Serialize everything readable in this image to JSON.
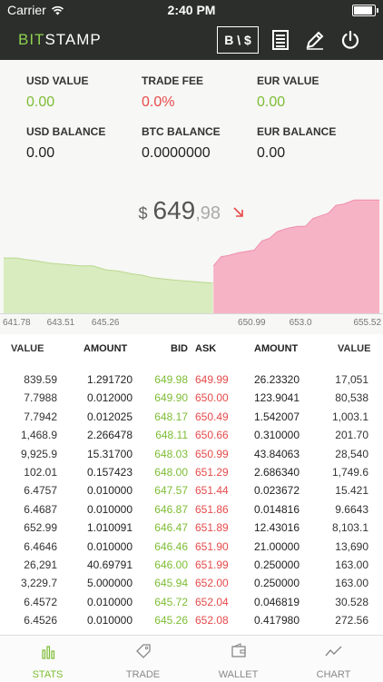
{
  "status_bar": {
    "carrier": "Carrier",
    "time": "2:40 PM",
    "battery_level": 1.0
  },
  "app": {
    "brand_bit": "BIT",
    "brand_stamp": "STAMP",
    "currency_toggle": "B \\ $"
  },
  "colors": {
    "accent_green": "#7dbd34",
    "accent_red": "#e64a4a",
    "nav_bg": "#2b2e2b"
  },
  "stats": [
    {
      "label": "USD VALUE",
      "value": "0.00",
      "tone": "green"
    },
    {
      "label": "TRADE FEE",
      "value": "0.0%",
      "tone": "red"
    },
    {
      "label": "EUR VALUE",
      "value": "0.00",
      "tone": "green"
    },
    {
      "label": "USD BALANCE",
      "value": "0.00",
      "tone": "plain"
    },
    {
      "label": "BTC BALANCE",
      "value": "0.0000000",
      "tone": "plain"
    },
    {
      "label": "EUR BALANCE",
      "value": "0.00",
      "tone": "plain"
    }
  ],
  "price": {
    "currency": "$",
    "main": "649",
    "decimal": ",98",
    "direction": "down"
  },
  "chart_data": {
    "type": "area",
    "x_ticks": [
      "641.78",
      "643.51",
      "645.26",
      "650.99",
      "653.0",
      "655.52"
    ],
    "xlim": [
      641.78,
      656.5
    ],
    "ylim": [
      0,
      1
    ],
    "series": [
      {
        "side": "bid",
        "color": "#d8ecbf",
        "points": [
          [
            641.78,
            0.42
          ],
          [
            642.3,
            0.42
          ],
          [
            642.6,
            0.41
          ],
          [
            643.0,
            0.4
          ],
          [
            643.6,
            0.38
          ],
          [
            644.2,
            0.37
          ],
          [
            644.8,
            0.36
          ],
          [
            645.26,
            0.36
          ],
          [
            645.8,
            0.33
          ],
          [
            646.3,
            0.32
          ],
          [
            646.8,
            0.3
          ],
          [
            647.2,
            0.29
          ],
          [
            647.6,
            0.27
          ],
          [
            648.1,
            0.26
          ],
          [
            648.6,
            0.25
          ],
          [
            649.3,
            0.24
          ],
          [
            649.98,
            0.23
          ]
        ]
      },
      {
        "side": "ask",
        "color": "#f7b3c6",
        "points": [
          [
            650.0,
            0.36
          ],
          [
            650.3,
            0.43
          ],
          [
            650.6,
            0.44
          ],
          [
            650.99,
            0.46
          ],
          [
            651.3,
            0.47
          ],
          [
            651.6,
            0.48
          ],
          [
            651.9,
            0.55
          ],
          [
            652.2,
            0.57
          ],
          [
            652.5,
            0.62
          ],
          [
            652.8,
            0.64
          ],
          [
            653.0,
            0.65
          ],
          [
            653.3,
            0.66
          ],
          [
            653.6,
            0.66
          ],
          [
            653.9,
            0.72
          ],
          [
            654.2,
            0.74
          ],
          [
            654.5,
            0.76
          ],
          [
            654.8,
            0.82
          ],
          [
            655.1,
            0.83
          ],
          [
            655.52,
            0.86
          ],
          [
            656.0,
            0.86
          ],
          [
            656.5,
            0.86
          ]
        ]
      }
    ]
  },
  "order_book": {
    "headers": {
      "value1": "VALUE",
      "amount1": "AMOUNT",
      "bid": "BID",
      "ask": "ASK",
      "amount2": "AMOUNT",
      "value2": "VALUE"
    },
    "rows": [
      [
        "839.59",
        "1.291720",
        "649.98",
        "649.99",
        "26.23320",
        "17,051"
      ],
      [
        "7.7988",
        "0.012000",
        "649.90",
        "650.00",
        "123.9041",
        "80,538"
      ],
      [
        "7.7942",
        "0.012025",
        "648.17",
        "650.49",
        "1.542007",
        "1,003.1"
      ],
      [
        "1,468.9",
        "2.266478",
        "648.11",
        "650.66",
        "0.310000",
        "201.70"
      ],
      [
        "9,925.9",
        "15.31700",
        "648.03",
        "650.99",
        "43.84063",
        "28,540"
      ],
      [
        "102.01",
        "0.157423",
        "648.00",
        "651.29",
        "2.686340",
        "1,749.6"
      ],
      [
        "6.4757",
        "0.010000",
        "647.57",
        "651.44",
        "0.023672",
        "15.421"
      ],
      [
        "6.4687",
        "0.010000",
        "646.87",
        "651.86",
        "0.014816",
        "9.6643"
      ],
      [
        "652.99",
        "1.010091",
        "646.47",
        "651.89",
        "12.43016",
        "8,103.1"
      ],
      [
        "6.4646",
        "0.010000",
        "646.46",
        "651.90",
        "21.00000",
        "13,690"
      ],
      [
        "26,291",
        "40.69791",
        "646.00",
        "651.99",
        "0.250000",
        "163.00"
      ],
      [
        "3,229.7",
        "5.000000",
        "645.94",
        "652.00",
        "0.250000",
        "163.00"
      ],
      [
        "6.4572",
        "0.010000",
        "645.72",
        "652.04",
        "0.046819",
        "30.528"
      ],
      [
        "6.4526",
        "0.010000",
        "645.26",
        "652.08",
        "0.417980",
        "272.56"
      ]
    ]
  },
  "tabs": [
    {
      "label": "STATS",
      "icon": "bar-chart-icon",
      "active": true
    },
    {
      "label": "TRADE",
      "icon": "tag-icon",
      "active": false
    },
    {
      "label": "WALLET",
      "icon": "wallet-icon",
      "active": false
    },
    {
      "label": "CHART",
      "icon": "line-chart-icon",
      "active": false
    }
  ]
}
